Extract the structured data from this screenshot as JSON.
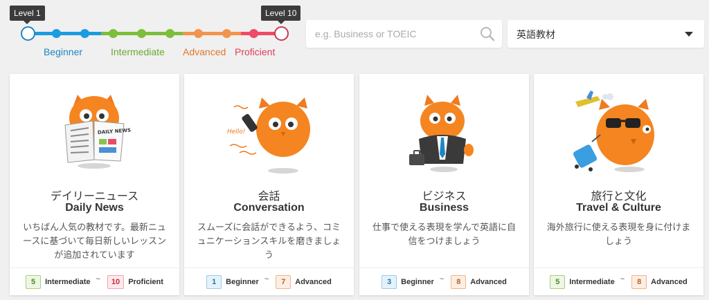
{
  "slider": {
    "min_label": "Level 1",
    "max_label": "Level 10",
    "bands": [
      {
        "label": "Beginner",
        "color": "#1d86c5"
      },
      {
        "label": "Intermediate",
        "color": "#7cbf3b"
      },
      {
        "label": "Advanced",
        "color": "#f38a3c"
      },
      {
        "label": "Proficient",
        "color": "#e84c64"
      }
    ],
    "selected_min": 1,
    "selected_max": 10
  },
  "search": {
    "placeholder": "e.g. Business or TOEIC",
    "value": ""
  },
  "category_select": {
    "value": "英語教材"
  },
  "cards": [
    {
      "title_jp": "デイリーニュース",
      "title_en": "Daily News",
      "description": "いちばん人気の教材です。最新ニュースに基づいて毎日新しいレッスンが追加されています",
      "art_text": "DAILY NEWS",
      "level_from": {
        "num": "5",
        "label": "Intermediate"
      },
      "level_to": {
        "num": "10",
        "label": "Proficient"
      }
    },
    {
      "title_jp": "会話",
      "title_en": "Conversation",
      "description": "スムーズに会話ができるよう、コミュニケーションスキルを磨きましょう",
      "art_text": "Hello!",
      "level_from": {
        "num": "1",
        "label": "Beginner"
      },
      "level_to": {
        "num": "7",
        "label": "Advanced"
      }
    },
    {
      "title_jp": "ビジネス",
      "title_en": "Business",
      "description": "仕事で使える表現を学んで英語に自信をつけましょう",
      "level_from": {
        "num": "3",
        "label": "Beginner"
      },
      "level_to": {
        "num": "8",
        "label": "Advanced"
      }
    },
    {
      "title_jp": "旅行と文化",
      "title_en": "Travel & Culture",
      "description": "海外旅行に使える表現を身に付けましょう",
      "level_from": {
        "num": "5",
        "label": "Intermediate"
      },
      "level_to": {
        "num": "8",
        "label": "Advanced"
      }
    }
  ]
}
